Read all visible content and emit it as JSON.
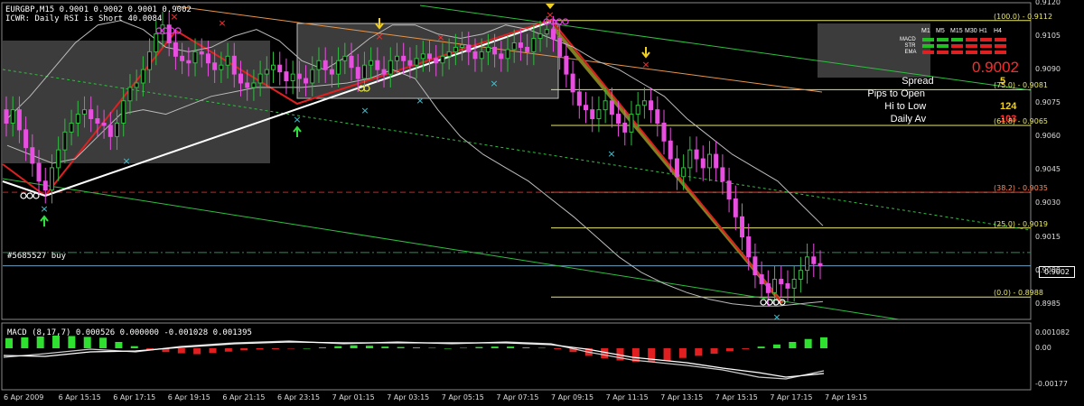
{
  "header": {
    "symbol_line": "EURGBP,M15  0.9001 0.9002 0.9001 0.9002",
    "indicator_line": "ICWR: Daily RSI is Short 40.0084"
  },
  "order_label": "#5685527 buy",
  "current_price": "0.9002",
  "panel": {
    "headers": [
      "M1",
      "M5",
      "M15",
      "M30",
      "H1",
      "H4"
    ],
    "rows": [
      "MACD",
      "STR",
      "EMA"
    ],
    "price": "0.9002",
    "items": [
      {
        "label": "Spread",
        "value": "5"
      },
      {
        "label": "Pips to Open",
        "value": ""
      },
      {
        "label": "Hi to Low",
        "value": "124"
      },
      {
        "label": "Daily Av",
        "value": "103"
      }
    ]
  },
  "fib_levels": [
    {
      "label": "(100.0) - 0.9112",
      "price": 0.9112
    },
    {
      "label": "(75.0) - 0.9081",
      "price": 0.9081
    },
    {
      "label": "(61.8) - 0.9065",
      "price": 0.9065
    },
    {
      "label": "(38.2) - 0.9035",
      "price": 0.9035
    },
    {
      "label": "(25.0) - 0.9019",
      "price": 0.9019
    },
    {
      "label": "(0.0) - 0.8988",
      "price": 0.8988
    }
  ],
  "macd": {
    "title": "MACD  (8,17,7) 0.000526 0.000000 -0.001028 0.001395",
    "yticks": [
      "0.001082",
      "0.00",
      "-0.00177"
    ]
  },
  "chart_data": {
    "type": "candlestick",
    "title": "EURGBP,M15",
    "ylim": [
      0.8978,
      0.912
    ],
    "yticks": [
      "0.9120",
      "0.9105",
      "0.9090",
      "0.9075",
      "0.9060",
      "0.9045",
      "0.9030",
      "0.9015",
      "0.9000",
      "0.8985"
    ],
    "xticks": [
      "6 Apr 2009",
      "6 Apr 15:15",
      "6 Apr 17:15",
      "6 Apr 19:15",
      "6 Apr 21:15",
      "6 Apr 23:15",
      "7 Apr 01:15",
      "7 Apr 03:15",
      "7 Apr 05:15",
      "7 Apr 07:15",
      "7 Apr 09:15",
      "7 Apr 11:15",
      "7 Apr 13:15",
      "7 Apr 15:15",
      "7 Apr 17:15",
      "7 Apr 19:15"
    ],
    "close": [
      0.9066,
      0.9072,
      0.9063,
      0.9055,
      0.9048,
      0.904,
      0.9036,
      0.9046,
      0.9054,
      0.9062,
      0.9066,
      0.907,
      0.9072,
      0.9068,
      0.9066,
      0.9065,
      0.906,
      0.9066,
      0.9076,
      0.9082,
      0.9084,
      0.909,
      0.9098,
      0.9106,
      0.911,
      0.9102,
      0.9096,
      0.9094,
      0.9093,
      0.9098,
      0.9097,
      0.9093,
      0.909,
      0.9092,
      0.9096,
      0.9088,
      0.9084,
      0.9082,
      0.9084,
      0.9088,
      0.909,
      0.9092,
      0.9089,
      0.9085,
      0.9088,
      0.9086,
      0.9084,
      0.909,
      0.9094,
      0.909,
      0.9088,
      0.9094,
      0.9096,
      0.9091,
      0.9086,
      0.9092,
      0.9094,
      0.909,
      0.9088,
      0.9094,
      0.9096,
      0.9094,
      0.9092,
      0.9095,
      0.9097,
      0.9095,
      0.9093,
      0.9096,
      0.9098,
      0.91,
      0.9101,
      0.9098,
      0.9095,
      0.9098,
      0.91,
      0.9097,
      0.9095,
      0.9099,
      0.9102,
      0.91,
      0.9098,
      0.9104,
      0.9106,
      0.9108,
      0.9104,
      0.9096,
      0.9088,
      0.908,
      0.9074,
      0.9072,
      0.9068,
      0.9072,
      0.9076,
      0.907,
      0.9066,
      0.9062,
      0.907,
      0.9074,
      0.9076,
      0.9072,
      0.9066,
      0.9058,
      0.905,
      0.9042,
      0.9046,
      0.9054,
      0.905,
      0.9046,
      0.9052,
      0.9046,
      0.904,
      0.9032,
      0.9024,
      0.9015,
      0.9006,
      0.8998,
      0.8994,
      0.899,
      0.8996,
      0.8994,
      0.8992,
      0.8996,
      0.9,
      0.9006,
      0.9003,
      0.9002
    ],
    "upper_band": [
      0.9068,
      0.9078,
      0.909,
      0.9102,
      0.911,
      0.9112,
      0.9108,
      0.91,
      0.9098,
      0.91,
      0.9105,
      0.9108,
      0.9103,
      0.9094,
      0.909,
      0.9096,
      0.9104,
      0.911,
      0.911,
      0.9106,
      0.9104,
      0.9106,
      0.911,
      0.9108,
      0.9104,
      0.91,
      0.9094,
      0.909,
      0.9084,
      0.9078,
      0.9068,
      0.906,
      0.9052,
      0.9046,
      0.904,
      0.903,
      0.902
    ],
    "lower_band": [
      0.9056,
      0.9052,
      0.9048,
      0.905,
      0.906,
      0.907,
      0.9072,
      0.907,
      0.9074,
      0.9078,
      0.908,
      0.9082,
      0.9082,
      0.9082,
      0.9083,
      0.9084,
      0.9086,
      0.909,
      0.9086,
      0.9072,
      0.906,
      0.9052,
      0.9046,
      0.904,
      0.9032,
      0.9024,
      0.9015,
      0.9006,
      0.8999,
      0.8994,
      0.899,
      0.8987,
      0.8985,
      0.8984,
      0.8984,
      0.8985,
      0.8986
    ],
    "macd_histogram": [
      0.00048,
      0.00052,
      0.00056,
      0.0006,
      0.00058,
      0.00054,
      0.0005,
      0.0003,
      0.0001,
      -0.0001,
      -0.00018,
      -0.00024,
      -0.00028,
      -0.00022,
      -0.00016,
      -0.0001,
      -6e-05,
      -4e-05,
      -2e-05,
      0.0,
      4e-05,
      0.0001,
      0.00014,
      0.00012,
      8e-05,
      6e-05,
      4e-05,
      2e-05,
      0.0,
      2e-05,
      6e-05,
      8e-05,
      8e-05,
      4e-05,
      2e-05,
      -4e-05,
      -0.00018,
      -0.00036,
      -0.00048,
      -0.00058,
      -0.00064,
      -0.00066,
      -0.00058,
      -0.00046,
      -0.00036,
      -0.00026,
      -0.00014,
      -4e-05,
      8e-05,
      0.00018,
      0.0003,
      0.00044,
      0.00052
    ]
  }
}
